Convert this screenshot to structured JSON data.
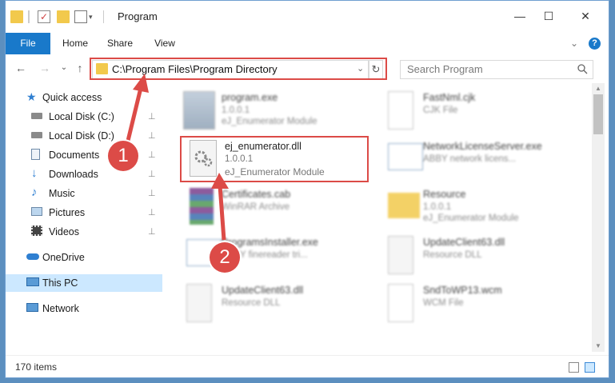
{
  "title": "Program",
  "window_controls": {
    "minimize": "—",
    "maximize": "☐",
    "close": "✕"
  },
  "ribbon": {
    "tabs": [
      "File",
      "Home",
      "Share",
      "View"
    ],
    "help": "?",
    "expand": "⌄"
  },
  "nav": {
    "back": "←",
    "forward": "→",
    "recent": "⌄",
    "up": "↑",
    "address": "C:\\Program Files\\Program Directory",
    "search_placeholder": "Search Program",
    "address_dropdown": "⌄",
    "refresh": "↻"
  },
  "sidebar": {
    "items": [
      {
        "label": "Quick access",
        "icon": "star-icon"
      },
      {
        "label": "Local Disk (C:)",
        "icon": "drive-icon",
        "pinned": true
      },
      {
        "label": "Local Disk (D:)",
        "icon": "drive-icon",
        "pinned": true
      },
      {
        "label": "Documents",
        "icon": "documents-icon",
        "pinned": true
      },
      {
        "label": "Downloads",
        "icon": "downloads-icon",
        "pinned": true
      },
      {
        "label": "Music",
        "icon": "music-icon",
        "pinned": true
      },
      {
        "label": "Pictures",
        "icon": "pictures-icon",
        "pinned": true
      },
      {
        "label": "Videos",
        "icon": "videos-icon",
        "pinned": true
      },
      {
        "label": "OneDrive",
        "icon": "cloud-icon"
      },
      {
        "label": "This PC",
        "icon": "computer-icon",
        "selected": true
      },
      {
        "label": "Network",
        "icon": "network-icon"
      }
    ],
    "pin_glyph": "📌"
  },
  "files": [
    {
      "name": "program.exe",
      "line2": "1.0.0.1",
      "line3": "eJ_Enumerator Module",
      "icon": "exe-icon"
    },
    {
      "name": "FastNml.cjk",
      "line2": "CJK File",
      "line3": "",
      "icon": "file-icon"
    },
    {
      "name": "ej_enumerator.dll",
      "line2": "1.0.0.1",
      "line3": "eJ_Enumerator Module",
      "icon": "dll-gear-icon"
    },
    {
      "name": "NetworkLicenseServer.exe",
      "line2": "ABBY network licens...",
      "line3": "",
      "icon": "exe-icon"
    },
    {
      "name": "Certificates.cab",
      "line2": "WinRAR Archive",
      "line3": "",
      "icon": "archive-icon"
    },
    {
      "name": "Resource",
      "line2": "1.0.0.1",
      "line3": "eJ_Enumerator Module",
      "icon": "folder-icon"
    },
    {
      "name": "ProgramsInstaller.exe",
      "line2": "ABBY finereader tri...",
      "line3": "",
      "icon": "exe-icon"
    },
    {
      "name": "UpdateClient63.dll",
      "line2": "Resource DLL",
      "line3": "",
      "icon": "dll-gear-icon"
    },
    {
      "name": "UpdateClient63.dll",
      "line2": "Resource DLL",
      "line3": "",
      "icon": "dll-gear-icon"
    },
    {
      "name": "SndToWP13.wcm",
      "line2": "WCM File",
      "line3": "",
      "icon": "file-icon"
    }
  ],
  "status": {
    "count": "170 items"
  },
  "annotations": {
    "badge1": "1",
    "badge2": "2",
    "highlight_color": "#dc4b47"
  }
}
